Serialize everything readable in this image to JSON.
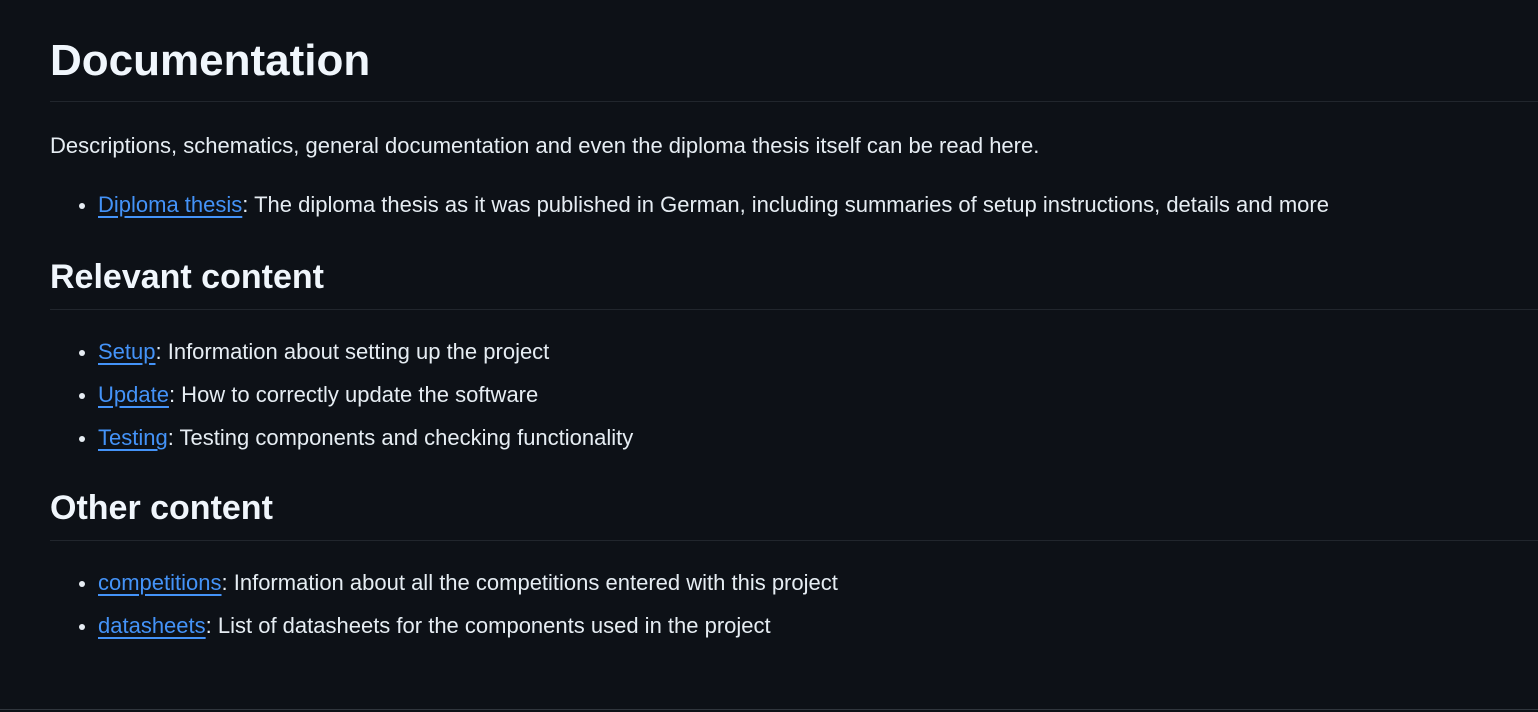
{
  "title": "Documentation",
  "intro": "Descriptions, schematics, general documentation and even the diploma thesis itself can be read here.",
  "top_list": [
    {
      "link": "Diploma thesis",
      "desc": ": The diploma thesis as it was published in German, including summaries of setup instructions, details and more"
    }
  ],
  "relevant": {
    "heading": "Relevant content",
    "items": [
      {
        "link": "Setup",
        "desc": ": Information about setting up the project"
      },
      {
        "link": "Update",
        "desc": ": How to correctly update the software"
      },
      {
        "link": "Testing",
        "desc": ": Testing components and checking functionality"
      }
    ]
  },
  "other": {
    "heading": "Other content",
    "items": [
      {
        "link": "competitions",
        "desc": ": Information about all the competitions entered with this project"
      },
      {
        "link": "datasheets",
        "desc": ": List of datasheets for the components used in the project"
      }
    ]
  },
  "colors": {
    "background": "#0d1117",
    "text": "#e6edf3",
    "link": "#4493f8",
    "divider": "#21262d"
  }
}
